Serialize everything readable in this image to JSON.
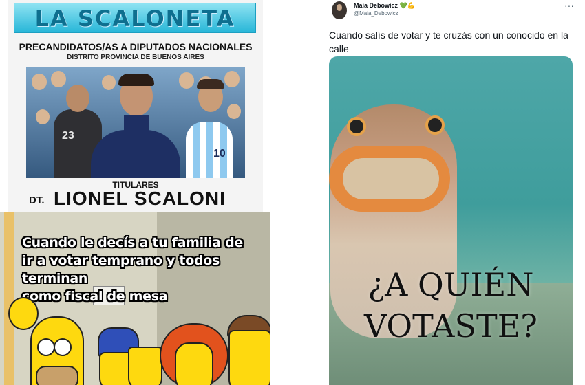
{
  "poster": {
    "title": "LA SCALONETA",
    "subtitle": "PRECANDIDATOS/AS A DIPUTADOS NACIONALES",
    "district": "DISTRITO PROVINCIA DE BUENOS AIRES",
    "label": "TITULARES",
    "name_prefix": "DT.",
    "name": "LIONEL SCALONI",
    "jersey_numbers": [
      "23",
      "10"
    ],
    "accent_color": "#27b6d8"
  },
  "simpsons": {
    "caption_lines": [
      "Cuando le decís a tu familia de",
      "ir a votar temprano y todos terminan",
      "como fiscal de mesa"
    ]
  },
  "tweet": {
    "author": "Maia Debowicz",
    "author_emoji": "💚💪",
    "handle": "@Maia_Debowicz",
    "more": "···",
    "text": "Cuando salís de votar y te cruzás con un conocido en la calle",
    "image_caption_line1": "¿A QUIÉN",
    "image_caption_line2": "VOTASTE?"
  }
}
